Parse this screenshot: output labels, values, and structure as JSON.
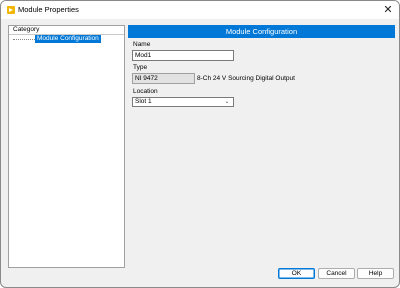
{
  "window": {
    "title": "Module Properties",
    "close_glyph": "✕",
    "icon": "labview-app-icon"
  },
  "category": {
    "header": "Category",
    "items": [
      {
        "label": "Module Configuration",
        "selected": true
      }
    ]
  },
  "config": {
    "header": "Module Configuration",
    "name_label": "Name",
    "name_value": "Mod1",
    "type_label": "Type",
    "type_value": "NI 9472",
    "type_description": "8-Ch 24 V Sourcing Digital Output",
    "location_label": "Location",
    "location_value": "Slot 1",
    "dropdown_glyph": "⌄"
  },
  "buttons": {
    "ok": "OK",
    "cancel": "Cancel",
    "help": "Help"
  },
  "colors": {
    "accent": "#0078d7",
    "app_icon": "#f2b705"
  }
}
